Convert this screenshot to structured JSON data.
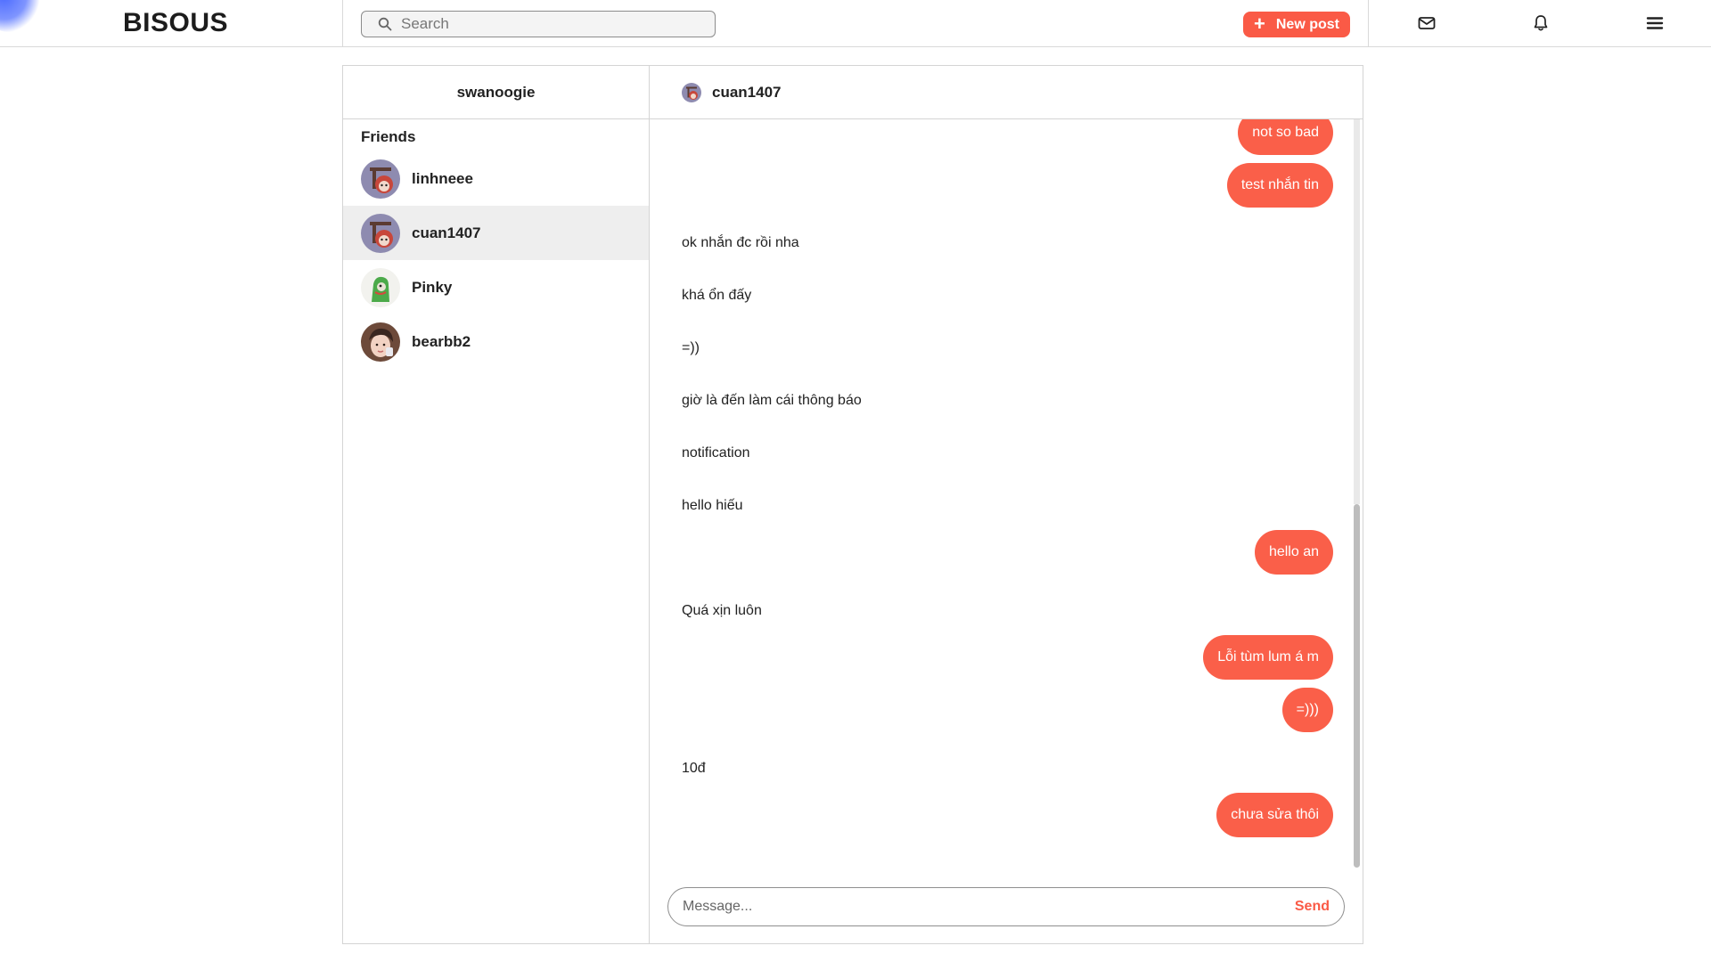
{
  "app": {
    "brand": "BISOUS"
  },
  "search": {
    "placeholder": "Search"
  },
  "toolbar": {
    "new_post_label": "New post",
    "accent": "#fa5a46"
  },
  "sidebar": {
    "current_user": "swanoogie",
    "friends_label": "Friends",
    "friends": [
      {
        "name": "linhneee",
        "avatar": "red-panda-avatar"
      },
      {
        "name": "cuan1407",
        "avatar": "red-panda-avatar",
        "active": true
      },
      {
        "name": "Pinky",
        "avatar": "green-dino-avatar"
      },
      {
        "name": "bearbb2",
        "avatar": "photo-avatar"
      }
    ]
  },
  "chat": {
    "partner": "cuan1407",
    "messages": [
      {
        "side": "out",
        "text": "not so bad"
      },
      {
        "side": "out",
        "text": "test nhắn tin"
      },
      {
        "side": "in",
        "text": "ok nhắn đc rồi nha"
      },
      {
        "side": "in",
        "text": "khá ổn đấy"
      },
      {
        "side": "in",
        "text": "=))"
      },
      {
        "side": "in",
        "text": "giờ là đến làm cái thông báo"
      },
      {
        "side": "in",
        "text": "notification"
      },
      {
        "side": "in",
        "text": "hello hiếu"
      },
      {
        "side": "out",
        "text": "hello an"
      },
      {
        "side": "in",
        "text": "Quá xịn luôn"
      },
      {
        "side": "out",
        "text": "Lỗi tùm lum á m"
      },
      {
        "side": "out",
        "text": "=)))"
      },
      {
        "side": "in",
        "text": "10đ"
      },
      {
        "side": "out",
        "text": "chưa sửa thôi"
      }
    ],
    "composer": {
      "placeholder": "Message...",
      "send_label": "Send"
    }
  }
}
